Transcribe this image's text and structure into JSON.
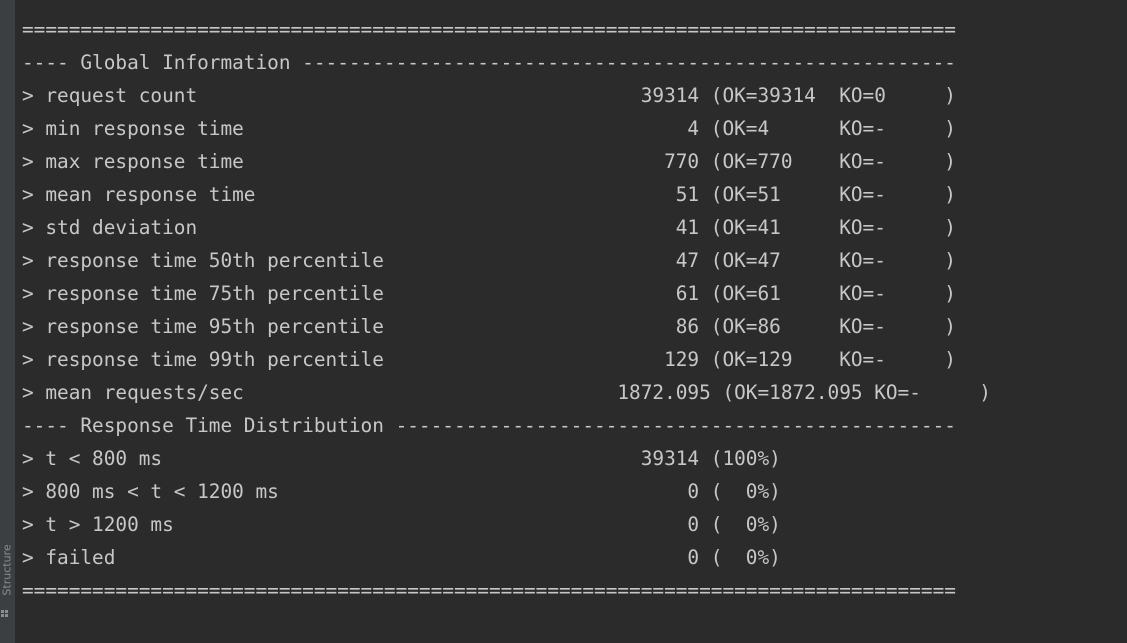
{
  "side_panel": {
    "structure_label": "Structure",
    "structure_icon": "structure-icon"
  },
  "console": {
    "lines": [
      "================================================================================",
      "---- Global Information --------------------------------------------------------",
      "> request count                                      39314 (OK=39314  KO=0     )",
      "> min response time                                      4 (OK=4      KO=-     )",
      "> max response time                                    770 (OK=770    KO=-     )",
      "> mean response time                                    51 (OK=51     KO=-     )",
      "> std deviation                                         41 (OK=41     KO=-     )",
      "> response time 50th percentile                         47 (OK=47     KO=-     )",
      "> response time 75th percentile                         61 (OK=61     KO=-     )",
      "> response time 95th percentile                         86 (OK=86     KO=-     )",
      "> response time 99th percentile                        129 (OK=129    KO=-     )",
      "> mean requests/sec                                1872.095 (OK=1872.095 KO=-     )",
      "---- Response Time Distribution ------------------------------------------------",
      "> t < 800 ms                                         39314 (100%)",
      "> 800 ms < t < 1200 ms                                   0 (  0%)",
      "> t > 1200 ms                                            0 (  0%)",
      "> failed                                                 0 (  0%)",
      "================================================================================"
    ]
  },
  "colors": {
    "background": "#2b2b2b",
    "text": "#c7c7c7",
    "side_strip": "#3c3f41",
    "side_text": "#8a8d90"
  }
}
